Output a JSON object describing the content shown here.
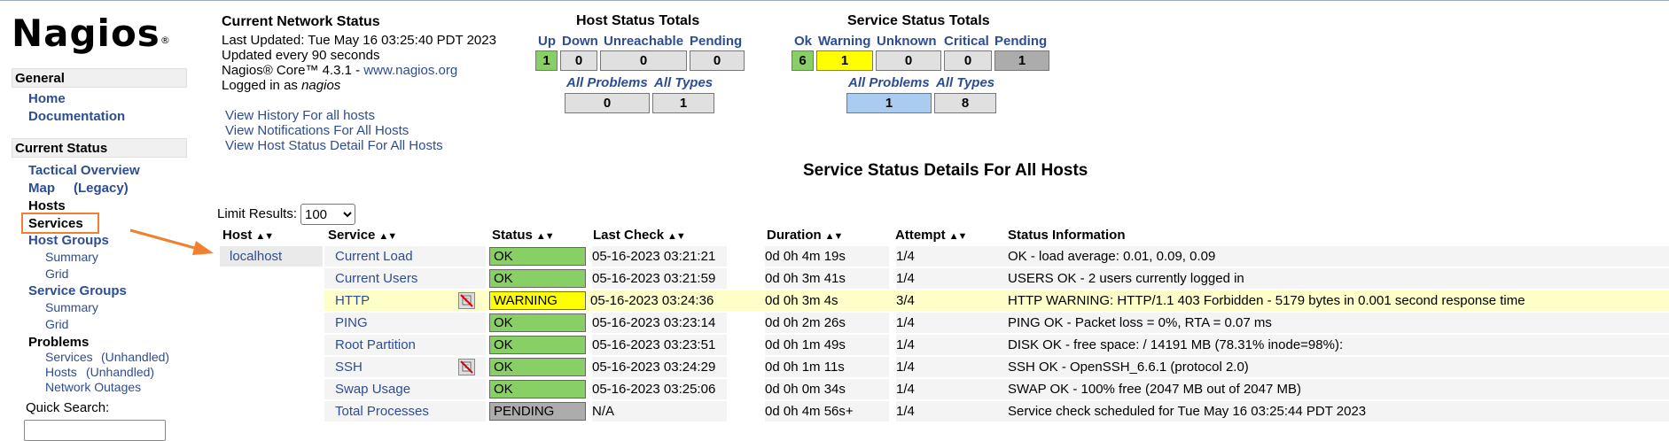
{
  "logo": {
    "text": "Nagios",
    "mark": "®"
  },
  "sidebar": {
    "general_header": "General",
    "home": "Home",
    "documentation": "Documentation",
    "current_status_header": "Current Status",
    "tactical": "Tactical Overview",
    "map": "Map",
    "map_legacy": "(Legacy)",
    "hosts": "Hosts",
    "services": "Services",
    "host_groups": "Host Groups",
    "hg_summary": "Summary",
    "hg_grid": "Grid",
    "service_groups": "Service Groups",
    "sg_summary": "Summary",
    "sg_grid": "Grid",
    "problems": "Problems",
    "prob_services": "Services",
    "prob_services_unhandled": "(Unhandled)",
    "prob_hosts": "Hosts",
    "prob_hosts_unhandled": "(Unhandled)",
    "network_outages": "Network Outages",
    "quick_search": "Quick Search:"
  },
  "status_info": {
    "title": "Current Network Status",
    "last_updated": "Last Updated: Tue May 16 03:25:40 PDT 2023",
    "updated_every": "Updated every 90 seconds",
    "core_version": "Nagios® Core™ 4.3.1 - ",
    "core_link": "www.nagios.org",
    "logged_in_prefix": "Logged in as ",
    "user": "nagios",
    "links": [
      "View History For all hosts",
      "View Notifications For All Hosts",
      "View Host Status Detail For All Hosts"
    ]
  },
  "host_totals": {
    "title": "Host Status Totals",
    "headers": [
      "Up",
      "Down",
      "Unreachable",
      "Pending"
    ],
    "values": [
      "1",
      "0",
      "0",
      "0"
    ],
    "problems_headers": [
      "All Problems",
      "All Types"
    ],
    "problems_values": [
      "0",
      "1"
    ]
  },
  "service_totals": {
    "title": "Service Status Totals",
    "headers": [
      "Ok",
      "Warning",
      "Unknown",
      "Critical",
      "Pending"
    ],
    "values": [
      "6",
      "1",
      "0",
      "0",
      "1"
    ],
    "problems_headers": [
      "All Problems",
      "All Types"
    ],
    "problems_values": [
      "1",
      "8"
    ]
  },
  "main": {
    "title": "Service Status Details For All Hosts",
    "limit_label": "Limit Results:",
    "limit_value": "100",
    "columns": [
      "Host",
      "Service",
      "Status",
      "Last Check",
      "Duration",
      "Attempt",
      "Status Information"
    ],
    "host": "localhost",
    "rows": [
      {
        "service": "Current Load",
        "status": "OK",
        "last_check": "05-16-2023 03:21:21",
        "duration": "0d 0h 4m 19s",
        "attempt": "1/4",
        "info": "OK - load average: 0.01, 0.09, 0.09"
      },
      {
        "service": "Current Users",
        "status": "OK",
        "last_check": "05-16-2023 03:21:59",
        "duration": "0d 0h 3m 41s",
        "attempt": "1/4",
        "info": "USERS OK - 2 users currently logged in"
      },
      {
        "service": "HTTP",
        "status": "WARNING",
        "last_check": "05-16-2023 03:24:36",
        "duration": "0d 0h 3m 4s",
        "attempt": "3/4",
        "info": "HTTP WARNING: HTTP/1.1 403 Forbidden - 5179 bytes in 0.001 second response time"
      },
      {
        "service": "PING",
        "status": "OK",
        "last_check": "05-16-2023 03:23:14",
        "duration": "0d 0h 2m 26s",
        "attempt": "1/4",
        "info": "PING OK - Packet loss = 0%, RTA = 0.07 ms"
      },
      {
        "service": "Root Partition",
        "status": "OK",
        "last_check": "05-16-2023 03:23:51",
        "duration": "0d 0h 1m 49s",
        "attempt": "1/4",
        "info": "DISK OK - free space: / 14191 MB (78.31% inode=98%):"
      },
      {
        "service": "SSH",
        "status": "OK",
        "last_check": "05-16-2023 03:24:29",
        "duration": "0d 0h 1m 11s",
        "attempt": "1/4",
        "info": "SSH OK - OpenSSH_6.6.1 (protocol 2.0)"
      },
      {
        "service": "Swap Usage",
        "status": "OK",
        "last_check": "05-16-2023 03:25:06",
        "duration": "0d 0h 0m 34s",
        "attempt": "1/4",
        "info": "SWAP OK - 100% free (2047 MB out of 2047 MB)"
      },
      {
        "service": "Total Processes",
        "status": "PENDING",
        "last_check": "N/A",
        "duration": "0d 0h 4m 56s+",
        "attempt": "1/4",
        "info": "Service check scheduled for Tue May 16 03:25:44 PDT 2023"
      }
    ]
  },
  "colors": {
    "ok": "#88d066",
    "warning": "#ffff00",
    "pending": "#acacac",
    "link": "#2d4d93",
    "warning_row": "#fefec8",
    "highlight": "#f08030"
  },
  "icons": {
    "notifications_disabled": "notifications-disabled-icon",
    "sort": "sort-arrows-icon",
    "annotation_arrow": "orange-arrow-icon"
  }
}
